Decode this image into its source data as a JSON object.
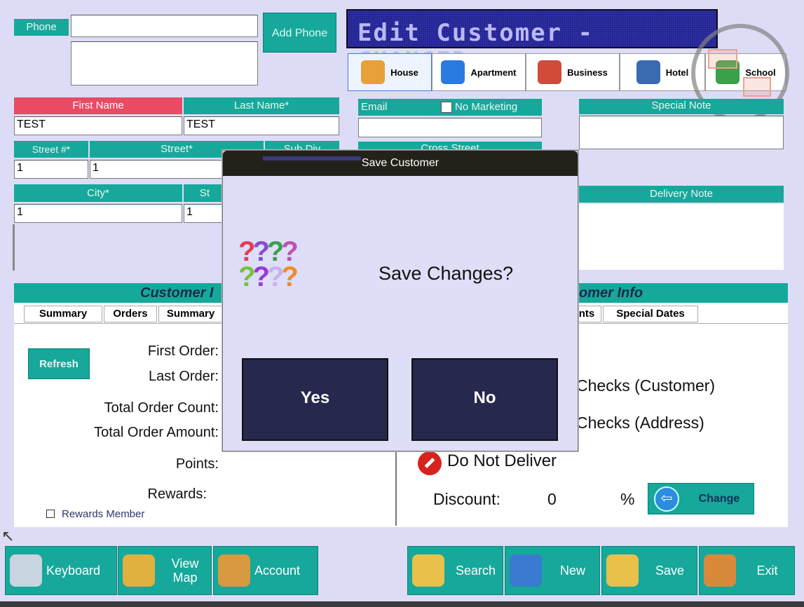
{
  "top": {
    "phone_label": "Phone",
    "add_phone_label": "Add Phone",
    "title": "Edit Customer - CHANGED"
  },
  "addr_types": [
    {
      "label": "House",
      "icon": "house-icon",
      "color": "#e8a03a"
    },
    {
      "label": "Apartment",
      "icon": "apartment-icon",
      "color": "#2a7be0"
    },
    {
      "label": "Business",
      "icon": "business-icon",
      "color": "#d24a3a"
    },
    {
      "label": "Hotel",
      "icon": "hotel-icon",
      "color": "#3a6ab0"
    },
    {
      "label": "School",
      "icon": "school-icon",
      "color": "#3aa04a"
    }
  ],
  "form": {
    "first_name_label": "First Name",
    "first_name": "TEST",
    "last_name_label": "Last Name*",
    "last_name": "TEST",
    "street_no_label": "Street #*",
    "street_no": "1",
    "street_label": "Street*",
    "street": "1",
    "sub_div_label": "Sub Div",
    "city_label": "City*",
    "city": "1",
    "state_label": "St",
    "state": "1",
    "email_label": "Email",
    "no_marketing_label": "No Marketing",
    "cross_street_label": "Cross Street",
    "special_note_label": "Special Note",
    "delivery_note_label": "Delivery Note"
  },
  "info": {
    "left_title": "Customer I",
    "right_title": "omer Info",
    "tabs_left": [
      "Summary",
      "Orders",
      "Summary"
    ],
    "tabs_right": [
      "nts",
      "Special Dates"
    ],
    "refresh_label": "Refresh",
    "first_order_label": "First Order:",
    "last_order_label": "Last Order:",
    "total_count_label": "Total Order Count:",
    "total_amount_label": "Total Order Amount:",
    "points_label": "Points:",
    "rewards_label": "Rewards:",
    "rewards_member_label": "Rewards Member",
    "checks_customer_label": "Checks (Customer)",
    "checks_address_label": "Checks (Address)",
    "do_not_deliver_label": "Do Not Deliver",
    "discount_label": "Discount:",
    "discount_value": "0",
    "discount_unit": "%",
    "change_label": "Change"
  },
  "bottom": {
    "keyboard": "Keyboard",
    "view_map_1": "View",
    "view_map_2": "Map",
    "account": "Account",
    "search": "Search",
    "new": "New",
    "save": "Save",
    "exit": "Exit"
  },
  "dialog": {
    "title": "Save Customer",
    "message": "Save Changes?",
    "yes": "Yes",
    "no": "No"
  }
}
